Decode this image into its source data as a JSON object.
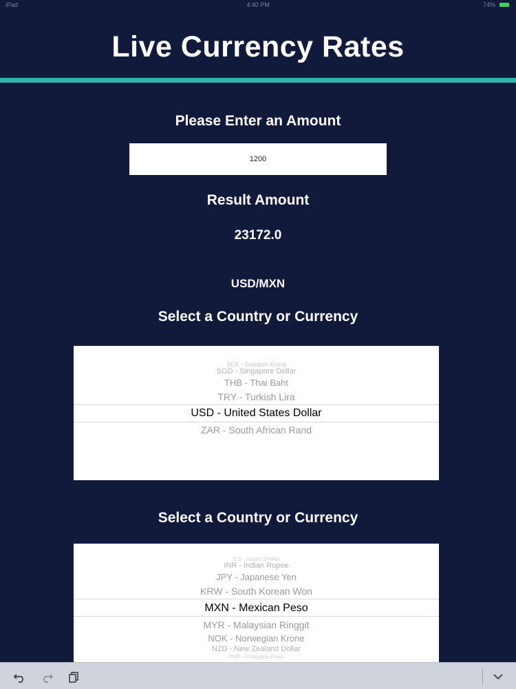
{
  "status_bar": {
    "carrier": "iPad",
    "time": "4:40 PM",
    "battery": "74%"
  },
  "title": "Live Currency Rates",
  "amount_label": "Please Enter an Amount",
  "amount_value": "1200",
  "result_label": "Result Amount",
  "result_value": "23172.0",
  "currency_pair": "USD/MXN",
  "picker_label_1": "Select a Country or Currency",
  "picker_label_2": "Select a Country or Currency",
  "picker_1": {
    "items": [
      "SEK - Swedish Krona",
      "SGD - Singapore Dollar",
      "THB - Thai Baht",
      "TRY - Turkish Lira",
      "USD - United States Dollar",
      "ZAR - South African Rand"
    ],
    "selected": "USD - United States Dollar"
  },
  "picker_2": {
    "items": [
      "ILS - Israeli Shekel",
      "INR - Indian Rupee",
      "JPY - Japanese Yen",
      "KRW - South Korean Won",
      "MXN - Mexican Peso",
      "MYR - Malaysian Ringgit",
      "NOK - Norwegian Krone",
      "NZD - New Zealand Dollar",
      "PHP - Philippine Peso"
    ],
    "selected": "MXN - Mexican Peso"
  },
  "toolbar": {
    "undo_icon": "undo-icon",
    "redo_icon": "redo-icon",
    "copy_icon": "copy-icon",
    "collapse_icon": "chevron-down-icon"
  },
  "colors": {
    "background": "#121a3b",
    "accent": "#2fb3aa",
    "battery": "#3fd15c"
  }
}
